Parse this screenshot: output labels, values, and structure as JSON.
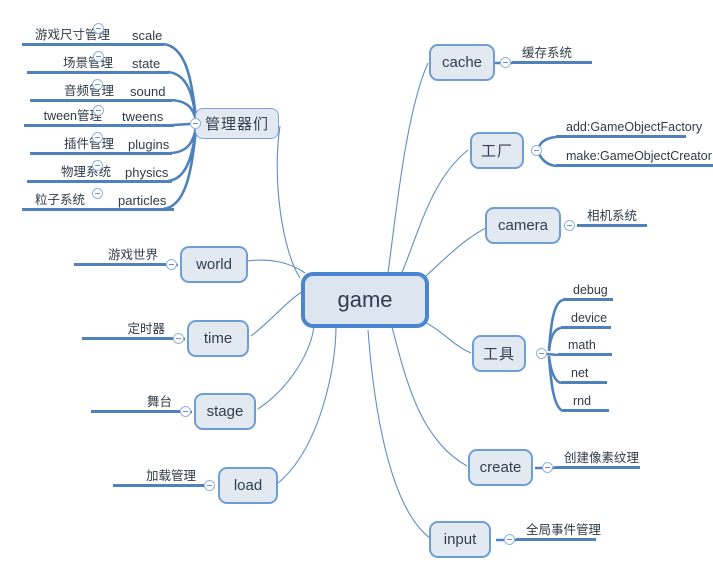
{
  "diagram": {
    "type": "mind-map",
    "title": "game",
    "background": "#ffffff",
    "colors": {
      "node_fill": "#e2e9f1",
      "node_border": "#6f9ed6",
      "root_border": "#4a86d0",
      "underline": "#4f81bd",
      "connector": "#5f8fc4",
      "text": "#2f3b47"
    }
  },
  "root": {
    "label": "game"
  },
  "managers_hub": {
    "label": "管理器们"
  },
  "managers": [
    {
      "cn": "游戏尺寸管理",
      "en": "scale"
    },
    {
      "cn": "场景管理",
      "en": "state"
    },
    {
      "cn": "音频管理",
      "en": "sound"
    },
    {
      "cn": "tween管理",
      "en": "tweens"
    },
    {
      "cn": "插件管理",
      "en": "plugins"
    },
    {
      "cn": "物理系统",
      "en": "physics"
    },
    {
      "cn": "粒子系统",
      "en": "particles"
    }
  ],
  "left_branches": [
    {
      "label": "world",
      "leaf": "游戏世界"
    },
    {
      "label": "time",
      "leaf": "定时器"
    },
    {
      "label": "stage",
      "leaf": "舞台"
    },
    {
      "label": "load",
      "leaf": "加载管理"
    }
  ],
  "right_branches": [
    {
      "label": "cache",
      "leaves": [
        "缓存系统"
      ]
    },
    {
      "label": "工厂",
      "leaves": [
        "add:GameObjectFactory",
        "make:GameObjectCreator"
      ]
    },
    {
      "label": "camera",
      "leaves": [
        "相机系统"
      ]
    },
    {
      "label": "工具",
      "leaves": [
        "debug",
        "device",
        "math",
        "net",
        "rnd"
      ]
    },
    {
      "label": "create",
      "leaves": [
        "创建像素纹理"
      ]
    },
    {
      "label": "input",
      "leaves": [
        "全局事件管理"
      ]
    }
  ],
  "icons": {
    "collapse": "minus-circle-icon"
  }
}
